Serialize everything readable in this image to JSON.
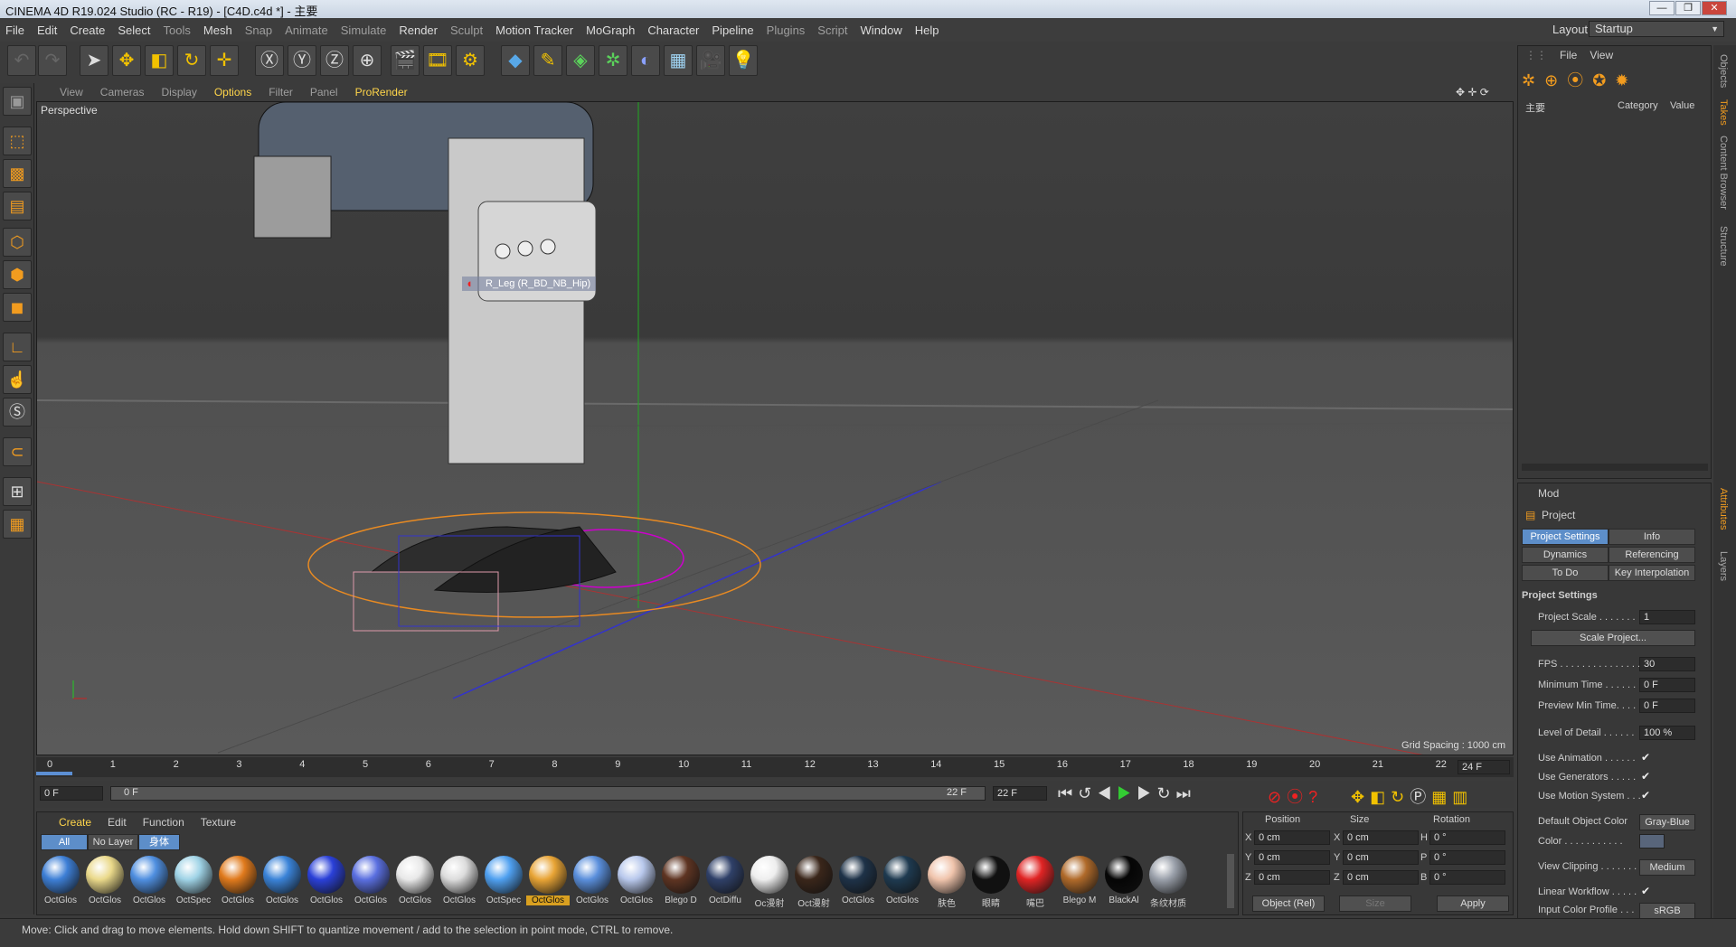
{
  "window": {
    "title": "CINEMA 4D R19.024 Studio (RC - R19) - [C4D.c4d *] - 主要",
    "minimize": "—",
    "maximize": "❐",
    "close": "✕"
  },
  "menubar": {
    "items": [
      "File",
      "Edit",
      "Create",
      "Select",
      "Tools",
      "Mesh",
      "Snap",
      "Animate",
      "Simulate",
      "Render",
      "Sculpt",
      "Motion Tracker",
      "MoGraph",
      "Character",
      "Pipeline",
      "Plugins",
      "Script",
      "Window",
      "Help"
    ],
    "layout_label": "Layout:",
    "layout_value": "Startup"
  },
  "viewport": {
    "menu": [
      "View",
      "Cameras",
      "Display",
      "Options",
      "Filter",
      "Panel",
      "ProRender"
    ],
    "camera": "Perspective",
    "tooltip": "R_Leg (R_BD_NB_Hip)",
    "grid_spacing": "Grid Spacing : 1000 cm"
  },
  "timeline": {
    "ticks": [
      "0",
      "1",
      "2",
      "3",
      "4",
      "5",
      "6",
      "7",
      "8",
      "9",
      "10",
      "11",
      "12",
      "13",
      "14",
      "15",
      "16",
      "17",
      "18",
      "19",
      "20",
      "21",
      "22"
    ],
    "end_frame": "24 F",
    "current": "0 F",
    "start": "0 F",
    "range_end": "22 F",
    "max": "22 F"
  },
  "materials": {
    "menu": [
      "Create",
      "Edit",
      "Function",
      "Texture"
    ],
    "layers": [
      "All",
      "No Layer",
      "身体"
    ],
    "items": [
      {
        "name": "OctGlos",
        "color": "#3d7fd6"
      },
      {
        "name": "OctGlos",
        "color": "#ead98a"
      },
      {
        "name": "OctGlos",
        "color": "#4f8fe0"
      },
      {
        "name": "OctSpec",
        "color": "#9fd3e6"
      },
      {
        "name": "OctGlos",
        "color": "#e07a1c"
      },
      {
        "name": "OctGlos",
        "color": "#3a83d8"
      },
      {
        "name": "OctGlos",
        "color": "#2a40d8"
      },
      {
        "name": "OctGlos",
        "color": "#5a6fe0"
      },
      {
        "name": "OctGlos",
        "color": "#e8e8e8"
      },
      {
        "name": "OctGlos",
        "color": "#dcdcdc"
      },
      {
        "name": "OctSpec",
        "color": "#4fa0f0"
      },
      {
        "name": "OctGlos",
        "color": "#e8a435"
      },
      {
        "name": "OctGlos",
        "color": "#5a8fdc"
      },
      {
        "name": "OctGlos",
        "color": "#b8c8ec"
      },
      {
        "name": "Blego D",
        "color": "#5e3422"
      },
      {
        "name": "OctDiffu",
        "color": "#2f4068"
      },
      {
        "name": "Oc漫射",
        "color": "#eeeeee"
      },
      {
        "name": "Oct漫射",
        "color": "#3a261a"
      },
      {
        "name": "OctGlos",
        "color": "#1e3248"
      },
      {
        "name": "OctGlos",
        "color": "#1e3a50"
      },
      {
        "name": "肤色",
        "color": "#f0c4ac"
      },
      {
        "name": "眼睛",
        "color": "#111111"
      },
      {
        "name": "嘴巴",
        "color": "#e02424"
      },
      {
        "name": "Blego M",
        "color": "#b06a2a"
      },
      {
        "name": "BlackAl",
        "color": "#050505"
      },
      {
        "name": "条纹材质",
        "color": "#9aa0aa"
      }
    ]
  },
  "coords": {
    "headers": [
      "Position",
      "Size",
      "Rotation"
    ],
    "rows": [
      {
        "axis": "X",
        "pos": "0 cm",
        "saxis": "X",
        "size": "0 cm",
        "raxis": "H",
        "rot": "0 °"
      },
      {
        "axis": "Y",
        "pos": "0 cm",
        "saxis": "Y",
        "size": "0 cm",
        "raxis": "P",
        "rot": "0 °"
      },
      {
        "axis": "Z",
        "pos": "0 cm",
        "saxis": "Z",
        "size": "0 cm",
        "raxis": "B",
        "rot": "0 °"
      }
    ],
    "mode": "Object (Rel)",
    "size_mode": "Size",
    "apply": "Apply"
  },
  "objects": {
    "menu": [
      "File",
      "View"
    ],
    "root": "主要",
    "col_category": "Category",
    "col_value": "Value"
  },
  "attributes": {
    "mode": "Mod",
    "title": "Project",
    "tabs": [
      "Project Settings",
      "Info",
      "Dynamics",
      "Referencing",
      "To Do",
      "Key Interpolation"
    ],
    "section": "Project Settings",
    "project_scale": {
      "label": "Project Scale . . . . . . .",
      "value": "1"
    },
    "scale_button": "Scale Project...",
    "fps": {
      "label": "FPS . . . . . . . . . . . . . . .",
      "value": "30"
    },
    "min_time": {
      "label": "Minimum Time . . . . . .",
      "value": "0 F"
    },
    "preview_min": {
      "label": "Preview Min Time. . . . .",
      "value": "0 F"
    },
    "lod": {
      "label": "Level of Detail . . . . . .",
      "value": "100 %"
    },
    "use_animation": {
      "label": "Use Animation . . . . . .",
      "value": "✔"
    },
    "use_generators": {
      "label": "Use Generators . . . . .",
      "value": "✔"
    },
    "use_motion": {
      "label": "Use Motion System . . .",
      "value": "✔"
    },
    "default_color": {
      "label": "Default Object Color",
      "value": "Gray-Blue"
    },
    "color": {
      "label": "Color . . . . . . . . . . ."
    },
    "view_clipping": {
      "label": "View Clipping . . . . . . .",
      "value": "Medium"
    },
    "linear_workflow": {
      "label": "Linear Workflow . . . . .",
      "value": "✔"
    },
    "input_profile": {
      "label": "Input Color Profile . . .",
      "value": "sRGB"
    }
  },
  "sidetabs": [
    "Objects",
    "Takes",
    "Content Browser",
    "Structure",
    "Attributes",
    "Layers"
  ],
  "status": "Move: Click and drag to move elements. Hold down SHIFT to quantize movement / add to the selection in point mode, CTRL to remove."
}
